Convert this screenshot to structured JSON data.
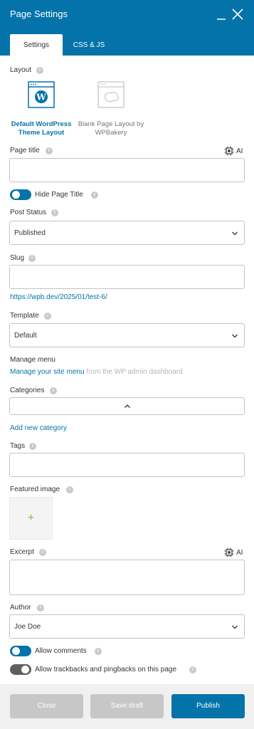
{
  "header": {
    "title": "Page Settings"
  },
  "tabs": {
    "settings": "Settings",
    "css_js": "CSS & JS"
  },
  "layout": {
    "label": "Layout",
    "default_label": "Default WordPress Theme Layout",
    "blank_label": "Blank Page Layout by WPBakery"
  },
  "page_title": {
    "label": "Page title",
    "value": "",
    "ai": "AI"
  },
  "hide_title": {
    "label": "Hide Page Title",
    "on": true
  },
  "post_status": {
    "label": "Post Status",
    "value": "Published"
  },
  "slug": {
    "label": "Slug",
    "value": "",
    "url": "https://wpb.dev/2025/01/test-6/"
  },
  "template": {
    "label": "Template",
    "value": "Default"
  },
  "manage_menu": {
    "label": "Manage menu",
    "link": "Manage your site menu",
    "suffix": "from the WP admin dashboard"
  },
  "categories": {
    "label": "Categories",
    "add_link": "Add new category"
  },
  "tags": {
    "label": "Tags",
    "value": ""
  },
  "featured_image": {
    "label": "Featured image",
    "plus": "+"
  },
  "excerpt": {
    "label": "Excerpt",
    "value": "",
    "ai": "AI"
  },
  "author": {
    "label": "Author",
    "value": "Joe Doe"
  },
  "allow_comments": {
    "label": "Allow comments",
    "on": true
  },
  "allow_trackbacks": {
    "label": "Allow trackbacks and pingbacks on this page",
    "on": false
  },
  "footer": {
    "close": "Close",
    "save_draft": "Save draft",
    "publish": "Publish"
  },
  "colors": {
    "accent": "#0473aa",
    "disabled": "#c7c7c7",
    "plus": "#7ac043"
  }
}
